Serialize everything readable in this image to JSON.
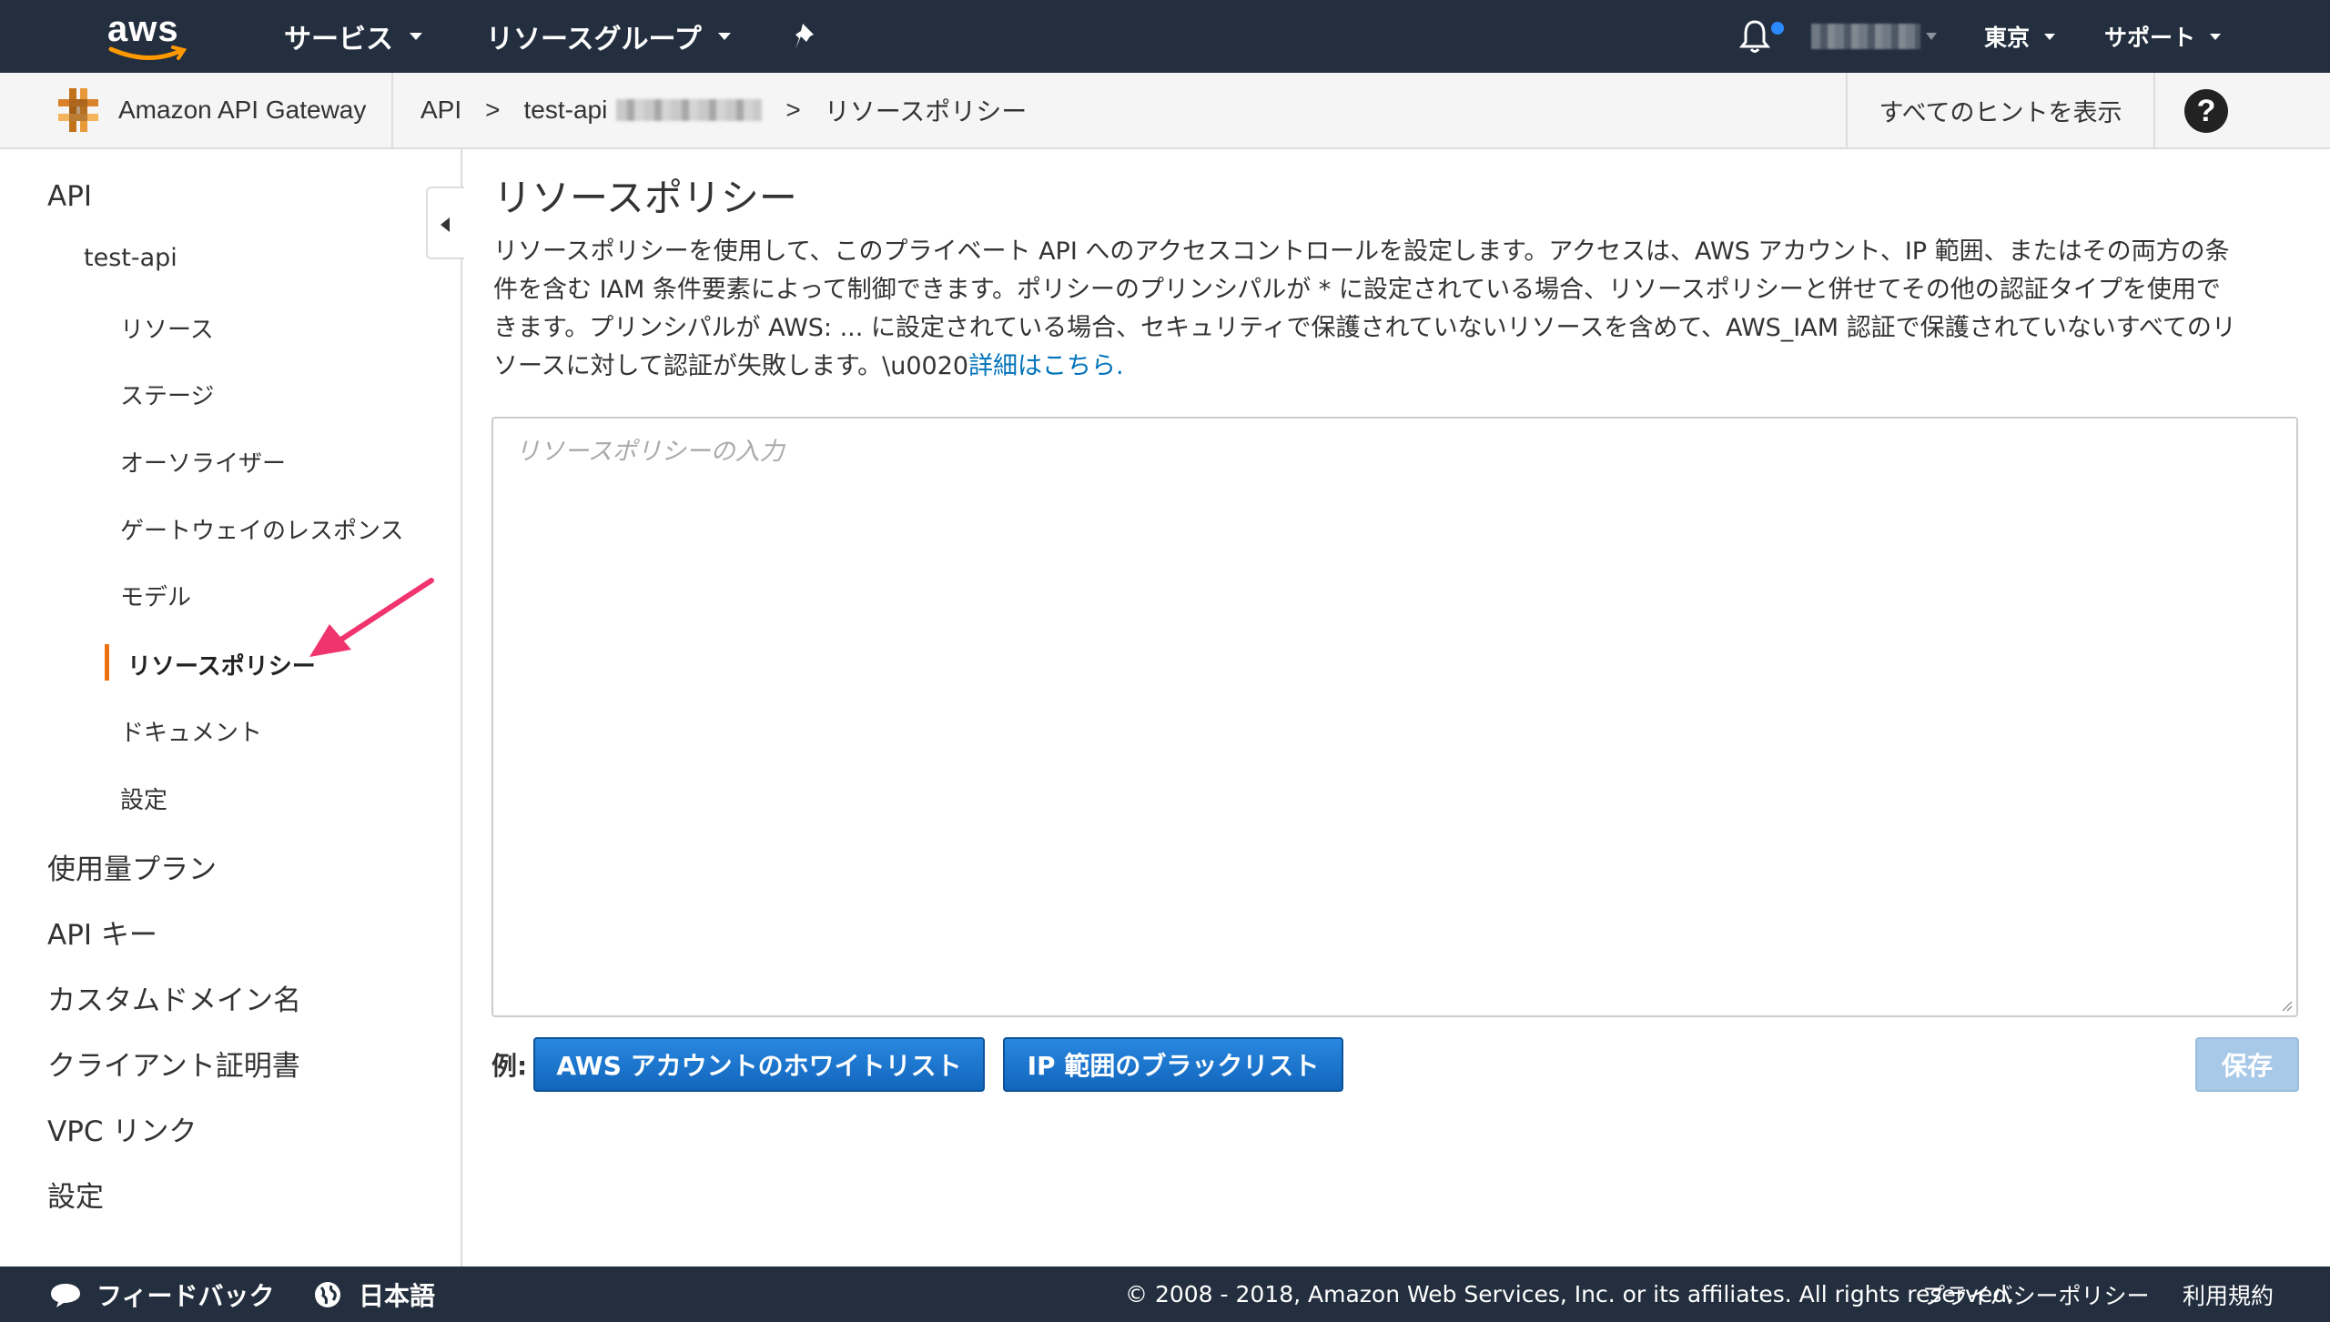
{
  "topnav": {
    "logo_text": "aws",
    "services_label": "サービス",
    "resource_groups_label": "リソースグループ",
    "region_label": "東京",
    "support_label": "サポート"
  },
  "servicebar": {
    "service_name": "Amazon API Gateway",
    "breadcrumb": [
      "API",
      "test-api",
      "リソースポリシー"
    ],
    "breadcrumb_separator": ">",
    "show_hints_label": "すべてのヒントを表示",
    "help_label": "?"
  },
  "sidebar": {
    "api_label": "API",
    "api_name": "test-api",
    "api_items": [
      "リソース",
      "ステージ",
      "オーソライザー",
      "ゲートウェイのレスポンス",
      "モデル",
      "リソースポリシー",
      "ドキュメント",
      "設定"
    ],
    "active_item": "リソースポリシー",
    "top_items": [
      "使用量プラン",
      "API キー",
      "カスタムドメイン名",
      "クライアント証明書",
      "VPC リンク",
      "設定"
    ]
  },
  "main": {
    "title": "リソースポリシー",
    "description_lines": [
      "リソースポリシーを使用して、このプライベート API へのアクセスコントロールを設定します。アクセスは、AWS アカウント、IP 範囲、またはその両方の条",
      "件を含む IAM 条件要素によって制御できます。ポリシーのプリンシパルが * に設定されている場合、リソースポリシーと併せてその他の認証タイプを使用で",
      "きます。プリンシパルが AWS: ... に設定されている場合、セキュリティで保護されていないリソースを含めて、AWS_IAM 認証で保護されていないすべてのリ",
      "ソースに対して認証が失敗します。\\u0020"
    ],
    "learn_more_link": "詳細はこちら.",
    "editor_placeholder": "リソースポリシーの入力",
    "examples_label": "例:",
    "example_buttons": [
      "AWS アカウントのホワイトリスト",
      "IP 範囲のブラックリスト"
    ],
    "save_label": "保存"
  },
  "footer": {
    "feedback_label": "フィードバック",
    "language_label": "日本語",
    "copyright": "© 2008 - 2018, Amazon Web Services, Inc. or its affiliates. All rights reserved.",
    "privacy_label": "プライバシーポリシー",
    "terms_label": "利用規約"
  },
  "colors": {
    "nav_bg": "#232f3e",
    "active_marker": "#ec7211",
    "link": "#0073bb",
    "primary_button": "#1166bb",
    "annotation_arrow": "#f0346e"
  }
}
